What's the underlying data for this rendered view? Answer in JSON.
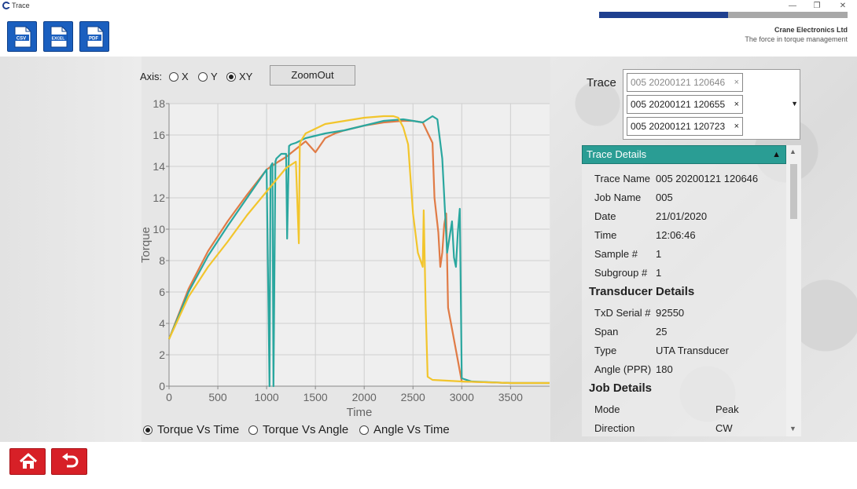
{
  "window": {
    "title": "Trace",
    "minimize": "—",
    "restore": "❐",
    "close": "✕"
  },
  "toolbar": {
    "buttons": [
      {
        "label": "CSV"
      },
      {
        "label": "EXCEL"
      },
      {
        "label": "PDF"
      }
    ]
  },
  "brand": {
    "company": "Crane Electronics Ltd",
    "tagline": "The force in torque management",
    "bar_dark_color": "#1e3f8f",
    "bar_grey_color": "#a8a8a8"
  },
  "axis": {
    "label": "Axis:",
    "options": [
      {
        "label": "X",
        "selected": false
      },
      {
        "label": "Y",
        "selected": false
      },
      {
        "label": "XY",
        "selected": true
      }
    ],
    "zoom_out": "ZoomOut"
  },
  "chart_data": {
    "type": "line",
    "xlabel": "Time",
    "ylabel": "Torque",
    "xlim": [
      0,
      3900
    ],
    "ylim": [
      0,
      18
    ],
    "x_ticks": [
      "0",
      "500",
      "1000",
      "1500",
      "2000",
      "2500",
      "3000",
      "3500"
    ],
    "y_ticks": [
      "0",
      "2",
      "4",
      "6",
      "8",
      "10",
      "12",
      "14",
      "16",
      "18"
    ],
    "grid": true,
    "series": [
      {
        "color": "#e07b46",
        "x": [
          0,
          200,
          400,
          600,
          800,
          1000,
          1120,
          1200,
          1300,
          1400,
          1500,
          1600,
          1700,
          1800,
          2000,
          2200,
          2400,
          2500,
          2600,
          2700,
          2720,
          2760,
          2780,
          2800,
          2820,
          2840,
          2860,
          3000,
          3500,
          3900
        ],
        "y": [
          3,
          6.2,
          8.6,
          10.5,
          12.2,
          13.8,
          14.3,
          14.6,
          15.1,
          15.6,
          14.9,
          15.8,
          16.1,
          16.3,
          16.6,
          16.8,
          16.9,
          16.9,
          16.8,
          15.5,
          12,
          9.8,
          7.6,
          8.5,
          10.3,
          11,
          5,
          0.3,
          0.2,
          0.2
        ]
      },
      {
        "color": "#2aa79f",
        "x": [
          0,
          200,
          400,
          600,
          800,
          1000,
          1030,
          1040,
          1060,
          1070,
          1090,
          1100,
          1150,
          1200,
          1210,
          1230,
          1250,
          1300,
          1400,
          1600,
          1800,
          2000,
          2200,
          2400,
          2500,
          2600,
          2700,
          2750,
          2800,
          2850,
          2900,
          2920,
          2940,
          2960,
          2980,
          3000,
          3100,
          3500,
          3900
        ],
        "y": [
          3,
          6,
          8.3,
          10.2,
          12,
          13.8,
          0,
          14,
          14.2,
          0,
          14.3,
          14.5,
          14.8,
          14.8,
          9.4,
          15.3,
          15.4,
          15.5,
          15.8,
          16.1,
          16.3,
          16.6,
          16.9,
          17,
          16.9,
          16.8,
          17.2,
          17,
          14.5,
          8.5,
          10.5,
          8.2,
          7.6,
          9.8,
          11.3,
          0.5,
          0.3,
          0.2,
          0.2
        ]
      },
      {
        "color": "#f2c52c",
        "x": [
          0,
          200,
          400,
          600,
          800,
          1000,
          1200,
          1300,
          1330,
          1340,
          1350,
          1400,
          1600,
          1800,
          2000,
          2200,
          2300,
          2350,
          2400,
          2450,
          2500,
          2550,
          2600,
          2610,
          2630,
          2650,
          2700,
          3000,
          3500,
          3900
        ],
        "y": [
          3,
          5.7,
          7.6,
          9.2,
          10.9,
          12.4,
          13.9,
          14.3,
          9.1,
          15.4,
          15.6,
          16.1,
          16.7,
          16.9,
          17.1,
          17.2,
          17.2,
          17.1,
          16.5,
          15.4,
          11,
          8.5,
          7.6,
          11.2,
          5,
          0.6,
          0.4,
          0.3,
          0.2,
          0.2
        ]
      }
    ]
  },
  "trace_selector": {
    "label": "Trace",
    "items": [
      {
        "name": "005 20200121 120646",
        "dimmed": true
      },
      {
        "name": "005 20200121 120655",
        "dimmed": false
      },
      {
        "name": "005 20200121 120723",
        "dimmed": false
      }
    ],
    "remove_glyph": "×",
    "dropdown_glyph": "▼"
  },
  "details": {
    "header": "Trace Details",
    "collapse_glyph": "▲",
    "trace_rows": [
      {
        "label": "Trace Name",
        "value": "005 20200121 120646"
      },
      {
        "label": "Job Name",
        "value": "005"
      },
      {
        "label": "Date",
        "value": "21/01/2020"
      },
      {
        "label": "Time",
        "value": "12:06:46"
      },
      {
        "label": "Sample #",
        "value": "1"
      },
      {
        "label": "Subgroup #",
        "value": "1"
      }
    ],
    "transducer_title": "Transducer Details",
    "transducer_rows": [
      {
        "label": "TxD Serial #",
        "value": "92550"
      },
      {
        "label": "Span",
        "value": "25"
      },
      {
        "label": "Type",
        "value": "UTA Transducer"
      },
      {
        "label": "Angle (PPR)",
        "value": "180"
      }
    ],
    "job_title": "Job Details",
    "job_rows": [
      {
        "label": "Mode",
        "value": "Peak"
      },
      {
        "label": "Direction",
        "value": "CW"
      }
    ],
    "scroll_up": "▲",
    "scroll_down": "▼"
  },
  "modes": [
    {
      "label": "Torque Vs Time",
      "selected": true
    },
    {
      "label": "Torque Vs Angle",
      "selected": false
    },
    {
      "label": "Angle Vs Time",
      "selected": false
    }
  ],
  "footer": {
    "home_icon": "home-icon",
    "back_icon": "back-arrow-icon",
    "button_color": "#d72027"
  }
}
